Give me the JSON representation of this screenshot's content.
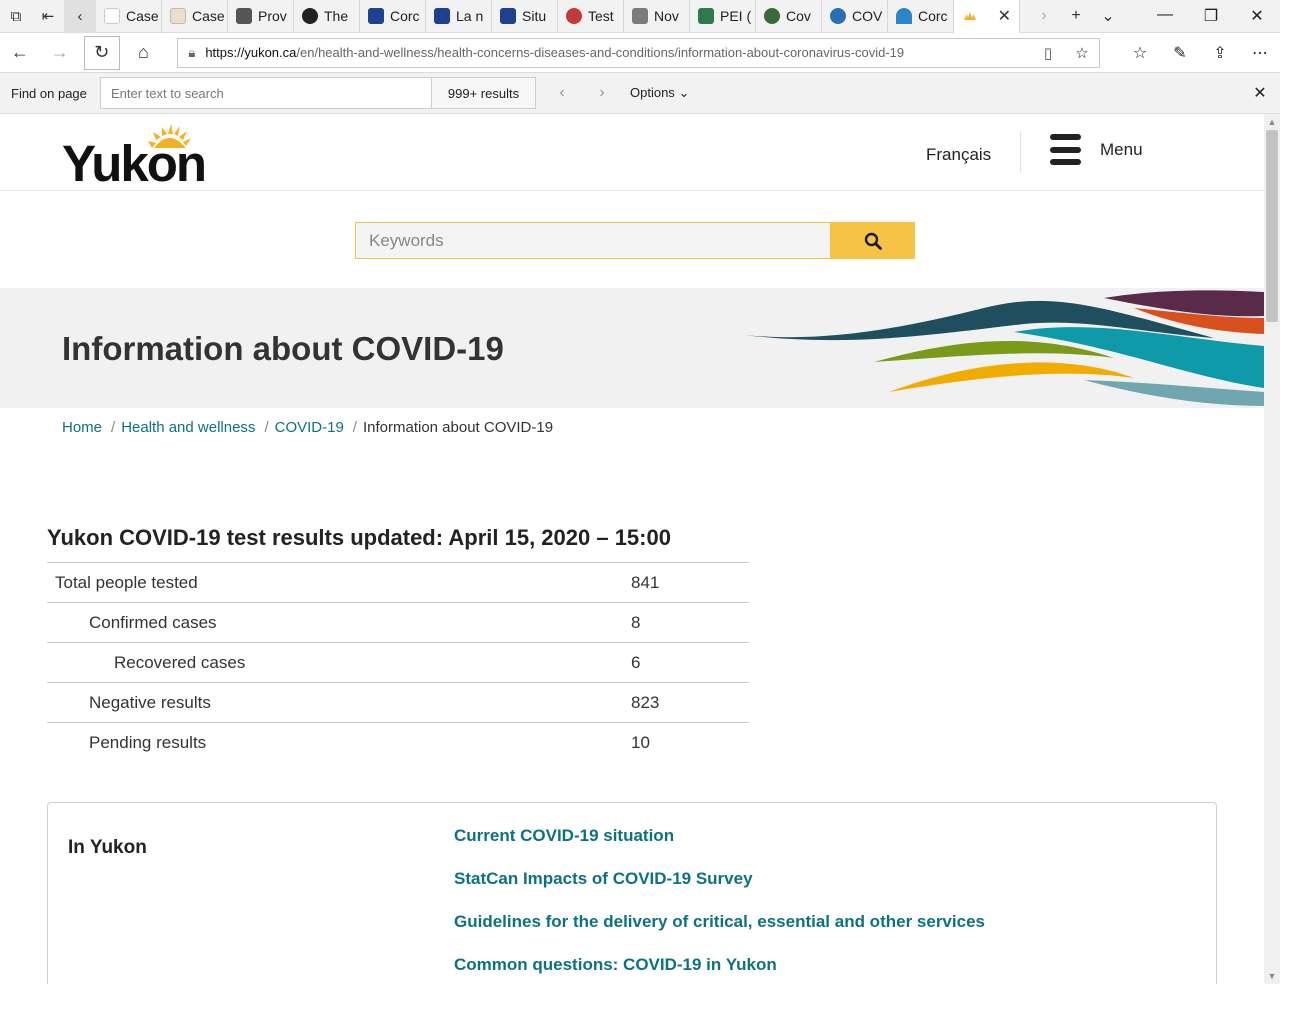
{
  "browser": {
    "tabs": [
      {
        "label": "Case",
        "color": "#ffffff"
      },
      {
        "label": "Case",
        "color": "#e8e0c8"
      },
      {
        "label": "Prov",
        "color": "#555555"
      },
      {
        "label": "The",
        "color": "#222222"
      },
      {
        "label": "Corc",
        "color": "#1f3f8f"
      },
      {
        "label": "La n",
        "color": "#1f3f8f"
      },
      {
        "label": "Situ",
        "color": "#1f3f8f"
      },
      {
        "label": "Test",
        "color": "#c23a3a"
      },
      {
        "label": "Nov",
        "color": "#7a7a7a"
      },
      {
        "label": "PEI (",
        "color": "#2f7a4a"
      },
      {
        "label": "Cov",
        "color": "#3a6a3a"
      },
      {
        "label": "COV",
        "color": "#2a6fb3"
      },
      {
        "label": "Corc",
        "color": "#2a86c9"
      }
    ],
    "url_host": "https://yukon.ca",
    "url_path": "/en/health-and-wellness/health-concerns-diseases-and-conditions/information-about-coronavirus-covid-19",
    "find": {
      "label": "Find on page",
      "placeholder": "Enter text to search",
      "count": "999+ results",
      "options": "Options"
    }
  },
  "site": {
    "logo": "Yukon",
    "language_link": "Français",
    "menu_label": "Menu",
    "search_placeholder": "Keywords"
  },
  "page": {
    "title": "Information about COVID-19",
    "breadcrumb": [
      "Home",
      "Health and wellness",
      "COVID-19",
      "Information about COVID-19"
    ],
    "results_title": "Yukon COVID-19 test results updated: April 15, 2020 – 15:00",
    "results": [
      {
        "label": "Total people tested",
        "value": "841"
      },
      {
        "label": "Confirmed cases",
        "value": "8"
      },
      {
        "label": "Recovered cases",
        "value": "6"
      },
      {
        "label": "Negative results",
        "value": "823"
      },
      {
        "label": "Pending results",
        "value": "10"
      }
    ],
    "in_yukon": {
      "heading": "In Yukon",
      "links": [
        "Current COVID-19 situation",
        "StatCan Impacts of COVID-19 Survey",
        "Guidelines for the delivery of critical, essential and other services",
        "Common questions: COVID-19 in Yukon"
      ]
    }
  },
  "colors": {
    "link": "#0c7280",
    "search_accent": "#f6c344"
  }
}
